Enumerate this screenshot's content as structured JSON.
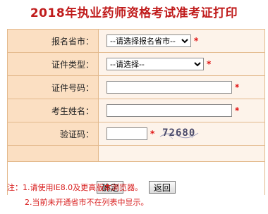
{
  "title": "2018年执业药师资格考试准考证打印",
  "form": {
    "province": {
      "label": "报名省市：",
      "value": "--请选择报名省市--",
      "arrow": "▼"
    },
    "cert_type": {
      "label": "证件类型：",
      "value": "--请选择--",
      "arrow": "▼"
    },
    "cert_no": {
      "label": "证件号码：",
      "value": ""
    },
    "name": {
      "label": "考生姓名：",
      "value": ""
    },
    "captcha": {
      "label": "验证码：",
      "value": "",
      "image_text": "72680"
    },
    "required_mark": "*"
  },
  "buttons": {
    "confirm": "确定",
    "back": "返回"
  },
  "notes": {
    "line1": "注：1.请使用IE8.0及更高版本浏览器。",
    "line2": "2.当前未开通省市不在列表中显示。"
  },
  "colors": {
    "title": "#c01c1c",
    "label_bg": "#fbdfc2",
    "border": "#e3b98c",
    "note": "#d81c1c"
  }
}
